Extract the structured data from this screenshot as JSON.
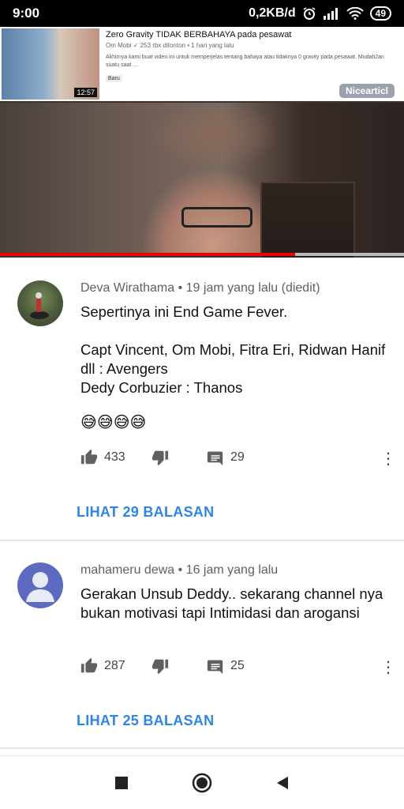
{
  "status_bar": {
    "time": "9:00",
    "network_speed": "0,2KB/d",
    "battery": "49"
  },
  "ad": {
    "title": "Zero Gravity TIDAK BERBAHAYA pada pesawat",
    "channel": "Om Mobi",
    "meta": "253 rbx ditonton • 1 hari yang lalu",
    "description": "Akhirnya kami buat video ini untuk memperjelas tentang bahaya atau tidaknya 0 gravity pada pesawat. Mudah2an suatu saat ...",
    "badge": "Baru",
    "duration": "12:57"
  },
  "watermark": "Nicearticl",
  "progress": {
    "fraction": 0.73
  },
  "comments": [
    {
      "author": "Deva Wirathama",
      "time": "• 19 jam yang lalu (diedit)",
      "text": "Sepertinya ini End Game Fever.\n\nCapt Vincent, Om Mobi, Fitra Eri, Ridwan Hanif dll : Avengers\nDedy Corbuzier : Thanos",
      "emoji": "😅😅😅😅",
      "likes": "433",
      "reply_count": "29",
      "view_replies": "LIHAT 29 BALASAN"
    },
    {
      "author": "mahameru dewa",
      "time": "• 16 jam yang lalu",
      "text": "Gerakan Unsub Deddy.. sekarang channel nya bukan motivasi tapi Intimidasi dan arogansi",
      "likes": "287",
      "reply_count": "25",
      "view_replies": "LIHAT 25 BALASAN"
    }
  ],
  "icons": [
    "wifi-icon",
    "signal-icon",
    "alarm-icon",
    "thumb-up-icon",
    "thumb-down-icon",
    "reply-icon",
    "more-vert-icon",
    "nav-recents-icon",
    "nav-home-icon",
    "nav-back-icon"
  ],
  "colors": {
    "link": "#2f86e0",
    "progress": "#e00000",
    "default_avatar": "#5c6bc0"
  }
}
